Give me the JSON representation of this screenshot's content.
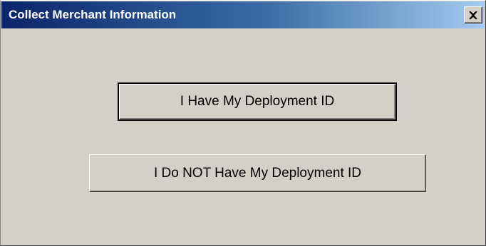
{
  "window": {
    "title": "Collect Merchant Information",
    "close_icon": "close-icon"
  },
  "buttons": {
    "have_id_label": "I Have My Deployment ID",
    "not_have_id_label": "I Do NOT Have My Deployment ID"
  },
  "colors": {
    "face": "#d4d0c8",
    "title_gradient_start": "#0a246a",
    "title_gradient_end": "#a6caf0",
    "title_text": "#ffffff"
  }
}
